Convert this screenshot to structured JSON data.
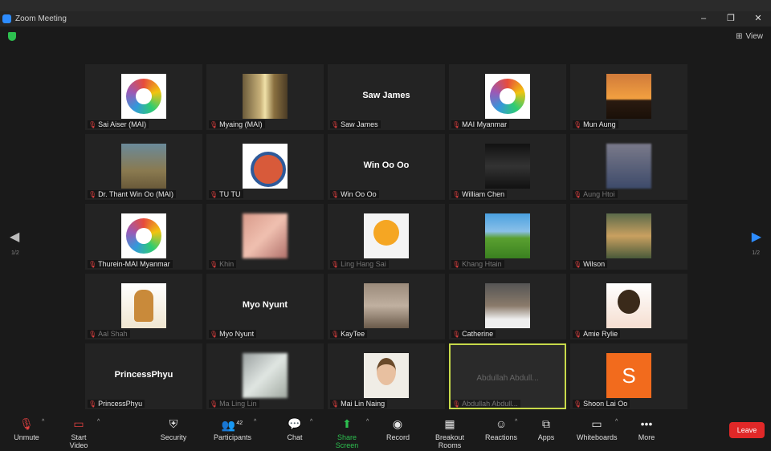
{
  "window": {
    "title": "Zoom Meeting",
    "view_label": "View"
  },
  "pager": {
    "page": "1/2"
  },
  "tiles": [
    {
      "name": "Sai Aiser (MAI)",
      "avatar": "av-logo"
    },
    {
      "name": "Myaing (MAI)",
      "avatar": "av-window"
    },
    {
      "name": "Saw James",
      "big": "Saw James"
    },
    {
      "name": "MAI Myanmar",
      "avatar": "av-logo"
    },
    {
      "name": "Mun Aung",
      "avatar": "av-sunset"
    },
    {
      "name": "Dr. Thant Win Oo (MAI)",
      "avatar": "av-person"
    },
    {
      "name": "TU TU",
      "avatar": "av-round"
    },
    {
      "name": "Win Oo Oo",
      "big": "Win Oo Oo"
    },
    {
      "name": "William Chen",
      "avatar": "av-dark"
    },
    {
      "name": "Aung Htoi",
      "avatar": "av-blur",
      "faded": true
    },
    {
      "name": "Thurein-MAI Myanmar",
      "avatar": "av-logo"
    },
    {
      "name": "Khin",
      "avatar": "av-pink",
      "faded": true
    },
    {
      "name": "Ling Hang Sai",
      "avatar": "av-emoji",
      "faded": true
    },
    {
      "name": "Khang Htain",
      "avatar": "av-field",
      "faded": true
    },
    {
      "name": "Wilson",
      "avatar": "av-dog"
    },
    {
      "name": "Aal Shah",
      "avatar": "av-warrior",
      "faded": true
    },
    {
      "name": "Myo Nyunt",
      "big": "Myo Nyunt"
    },
    {
      "name": "KayTee",
      "avatar": "av-man"
    },
    {
      "name": "Catherine",
      "avatar": "av-man2"
    },
    {
      "name": "Amie Rylie",
      "avatar": "av-kid"
    },
    {
      "name": "PrincessPhyu",
      "big": "PrincessPhyu"
    },
    {
      "name": "Ma Ling Lin",
      "avatar": "av-blur2",
      "faded": true
    },
    {
      "name": "Mai Lin Naing",
      "avatar": "av-boy"
    },
    {
      "name": "Abdullah Abdull...",
      "big": "Abdullah Abdull...",
      "big_dim": true,
      "faded": true,
      "active": true
    },
    {
      "name": "Shoon Lai Oo",
      "avatar": "av-s",
      "letter": "S"
    }
  ],
  "toolbar": {
    "unmute": "Unmute",
    "start_video": "Start Video",
    "security": "Security",
    "participants": "Participants",
    "participants_count": "42",
    "chat": "Chat",
    "share_screen": "Share Screen",
    "record": "Record",
    "breakout_rooms": "Breakout Rooms",
    "reactions": "Reactions",
    "apps": "Apps",
    "whiteboards": "Whiteboards",
    "more": "More",
    "leave": "Leave"
  },
  "colors": {
    "accent": "#2d8cff",
    "share_green": "#2dbf4f",
    "leave_red": "#e02828",
    "active_border": "#c7d94a"
  },
  "icons": {
    "unmute": "muted-mic-icon",
    "start_video": "video-off-icon",
    "security": "shield-icon",
    "participants": "people-icon",
    "chat": "chat-bubble-icon",
    "share_screen": "share-screen-icon",
    "record": "record-icon",
    "breakout_rooms": "grid-icon",
    "reactions": "smile-icon",
    "apps": "apps-icon",
    "whiteboards": "whiteboard-icon",
    "more": "dots-icon"
  }
}
